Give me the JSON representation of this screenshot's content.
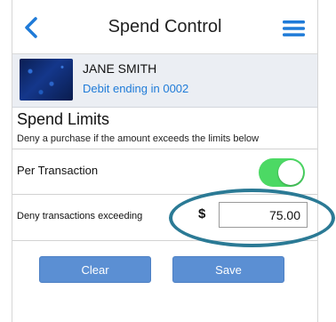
{
  "header": {
    "title": "Spend Control",
    "back_icon": "chevron-left-icon",
    "menu_icon": "hamburger-menu-icon"
  },
  "card": {
    "holder_name": "JANE SMITH",
    "subtitle": "Debit ending in 0002"
  },
  "spend_limits": {
    "title": "Spend Limits",
    "description": "Deny a purchase if the amount exceeds the limits below",
    "per_transaction": {
      "label": "Per Transaction",
      "enabled": true
    },
    "deny_label": "Deny transactions exceeding",
    "currency_symbol": "$",
    "amount": "75.00"
  },
  "actions": {
    "clear_label": "Clear",
    "save_label": "Save"
  },
  "colors": {
    "accent_blue": "#1f7bd8",
    "toggle_on": "#4cd964",
    "button_blue": "#5b8fd3",
    "highlight": "#2b7a95"
  }
}
